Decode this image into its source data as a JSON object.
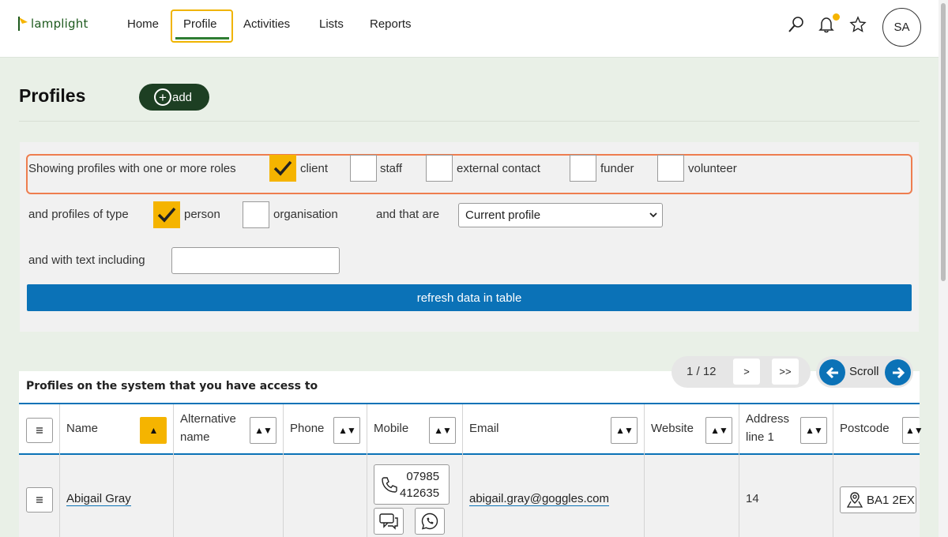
{
  "app": {
    "logo_text": "lamplight"
  },
  "nav": {
    "items": [
      "Home",
      "Profile",
      "Activities",
      "Lists",
      "Reports"
    ],
    "active": "Profile"
  },
  "header": {
    "avatar_initials": "SA",
    "icons": [
      "search-icon",
      "bell-icon",
      "star-icon"
    ],
    "accent": "#f5b400"
  },
  "page": {
    "title": "Profiles",
    "add_label": "add"
  },
  "filters": {
    "roles_label": "Showing profiles with one or more roles",
    "roles": [
      {
        "label": "client",
        "checked": true
      },
      {
        "label": "staff",
        "checked": false
      },
      {
        "label": "external contact",
        "checked": false
      },
      {
        "label": "funder",
        "checked": false
      },
      {
        "label": "volunteer",
        "checked": false
      }
    ],
    "type_label": "and profiles of type",
    "types": [
      {
        "label": "person",
        "checked": true
      },
      {
        "label": "organisation",
        "checked": false
      }
    ],
    "status_label": "and that are",
    "status_value": "Current profile",
    "text_label": "and with text including",
    "text_value": "",
    "refresh_label": "refresh data in table"
  },
  "pagination": {
    "page": "1 / 12",
    "next": ">",
    "last": ">>",
    "scroll_label": "Scroll"
  },
  "table": {
    "caption": "Profiles on the system that you have access to",
    "columns": [
      "Name",
      "Alternative name",
      "Phone",
      "Mobile",
      "Email",
      "Website",
      "Address line 1",
      "Postcode"
    ],
    "sort_symbol": "▲▼",
    "sort_active_symbol": "▲",
    "rows": [
      {
        "name": "Abigail Gray",
        "alternative_name": "",
        "phone": "",
        "mobile": "07985 412635",
        "mobile_line1": "07985",
        "mobile_line2": "412635",
        "email": "abigail.gray@goggles.com",
        "website": "",
        "address_line_1": "14",
        "postcode": "BA1 2EX"
      }
    ]
  },
  "colors": {
    "primary_blue": "#0b72b7",
    "dark_green": "#1d3f23",
    "highlight_orange": "#ee7d4f",
    "checkbox_yellow": "#f5b400"
  }
}
